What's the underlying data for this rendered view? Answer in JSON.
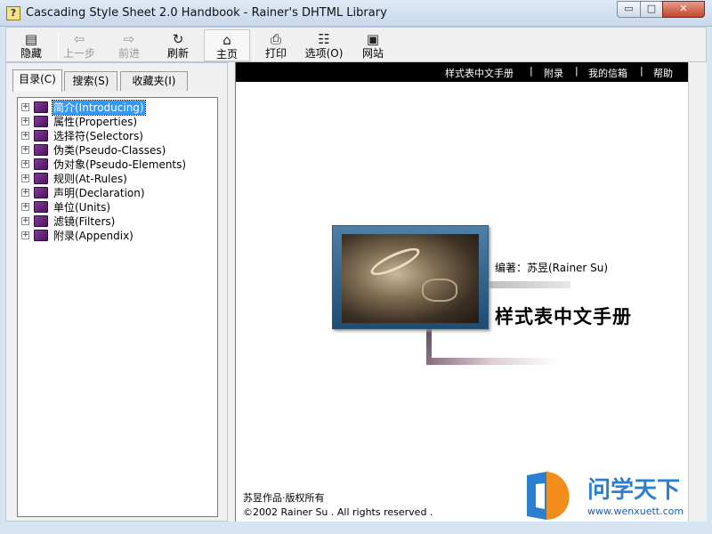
{
  "window": {
    "title": "Cascading Style Sheet 2.0 Handbook - Rainer's DHTML Library",
    "app_icon_glyph": "?",
    "controls": {
      "minimize": "▭",
      "maximize": "□",
      "close": "✕"
    }
  },
  "toolbar": {
    "buttons": [
      {
        "label": "隐藏",
        "icon": "hide-icon",
        "glyph": "▤",
        "enabled": true
      },
      {
        "label": "上一步",
        "icon": "back-arrow-icon",
        "glyph": "⇦",
        "enabled": false
      },
      {
        "label": "前进",
        "icon": "forward-arrow-icon",
        "glyph": "⇨",
        "enabled": false
      },
      {
        "label": "刷新",
        "icon": "refresh-icon",
        "glyph": "↻",
        "enabled": true
      },
      {
        "label": "主页",
        "icon": "home-icon",
        "glyph": "⌂",
        "enabled": true
      },
      {
        "label": "打印",
        "icon": "print-icon",
        "glyph": "⎙",
        "enabled": true
      },
      {
        "label": "选项(O)",
        "icon": "options-icon",
        "glyph": "☷",
        "enabled": true
      },
      {
        "label": "网站",
        "icon": "website-icon",
        "glyph": "▣",
        "enabled": true
      }
    ]
  },
  "tabs": [
    {
      "label": "目录(C)",
      "selected": true
    },
    {
      "label": "搜索(S)",
      "selected": false
    },
    {
      "label": "收藏夹(I)",
      "selected": false
    }
  ],
  "tree": {
    "items": [
      {
        "label": "简介(Introducing)",
        "selected": true
      },
      {
        "label": "属性(Properties)",
        "selected": false
      },
      {
        "label": "选择符(Selectors)",
        "selected": false
      },
      {
        "label": "伪类(Pseudo-Classes)",
        "selected": false
      },
      {
        "label": "伪对象(Pseudo-Elements)",
        "selected": false
      },
      {
        "label": "规则(At-Rules)",
        "selected": false
      },
      {
        "label": "声明(Declaration)",
        "selected": false
      },
      {
        "label": "单位(Units)",
        "selected": false
      },
      {
        "label": "滤镜(Filters)",
        "selected": false
      },
      {
        "label": "附录(Appendix)",
        "selected": false
      }
    ],
    "expander_glyph": "+"
  },
  "content": {
    "nav": [
      "样式表中文手册",
      "附录",
      "我的信箱",
      "帮助"
    ],
    "nav_separator": "|",
    "editor": "编著：苏昱(Rainer Su)",
    "book_title": "样式表中文手册",
    "footer_line1": "苏昱作品·版权所有",
    "footer_line2": "©2002 Rainer Su . All rights reserved ."
  },
  "watermark": {
    "text": "问学天下",
    "url": "www.wenxuett.com"
  },
  "colors": {
    "selection": "#3399ff",
    "nav_bar": "#000000",
    "book_icon": "#6a1f80"
  }
}
